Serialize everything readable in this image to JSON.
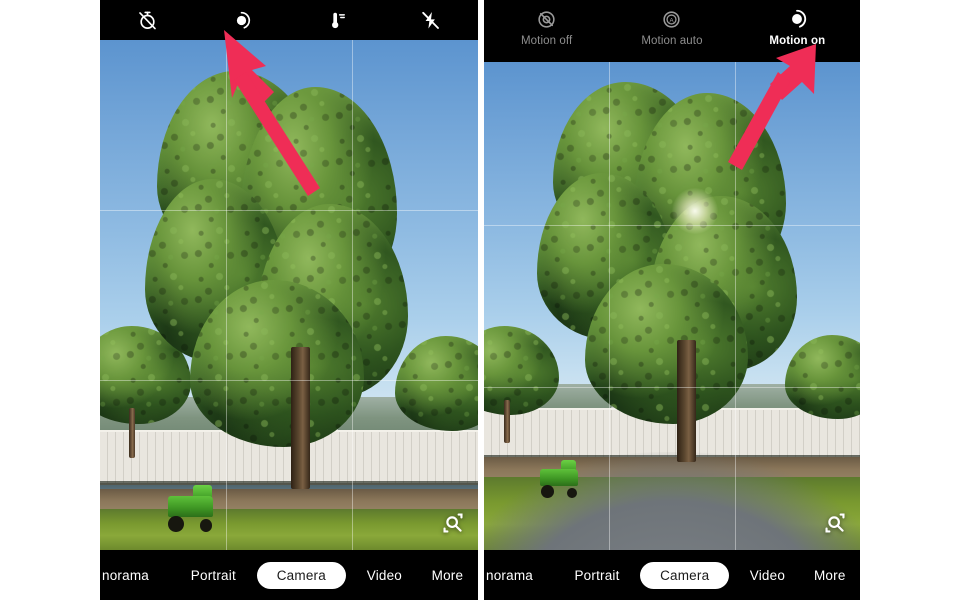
{
  "app": {
    "name": "Camera",
    "accent_pink": "#ef2d56",
    "bar_background": "#000000",
    "selected_pill_background": "#ffffff"
  },
  "left_phone": {
    "top_controls": [
      {
        "name": "timer-off",
        "label": "Timer off"
      },
      {
        "name": "motion",
        "label": "Motion"
      },
      {
        "name": "white-balance",
        "label": "White balance"
      },
      {
        "name": "flash-off",
        "label": "Flash off"
      }
    ],
    "viewfinder": {
      "grid": "rule-of-thirds",
      "zoom_badge_icon": "zoom-magnifier-icon"
    },
    "modes": [
      {
        "label": "norama",
        "selected": false,
        "clipped": true
      },
      {
        "label": "Portrait",
        "selected": false,
        "clipped": false
      },
      {
        "label": "Camera",
        "selected": true,
        "clipped": false
      },
      {
        "label": "Video",
        "selected": false,
        "clipped": false
      },
      {
        "label": "More",
        "selected": false,
        "clipped": false
      }
    ],
    "annotation": {
      "target": "motion-control",
      "direction": "up-left"
    }
  },
  "right_phone": {
    "motion_options": [
      {
        "label": "Motion off",
        "icon": "motion-off-icon",
        "selected": false
      },
      {
        "label": "Motion auto",
        "icon": "motion-auto-icon",
        "selected": false
      },
      {
        "label": "Motion on",
        "icon": "motion-on-icon",
        "selected": true
      }
    ],
    "viewfinder": {
      "grid": "rule-of-thirds",
      "zoom_badge_icon": "zoom-magnifier-icon"
    },
    "modes": [
      {
        "label": "norama",
        "selected": false,
        "clipped": true
      },
      {
        "label": "Portrait",
        "selected": false,
        "clipped": false
      },
      {
        "label": "Camera",
        "selected": true,
        "clipped": false
      },
      {
        "label": "Video",
        "selected": false,
        "clipped": false
      },
      {
        "label": "More",
        "selected": false,
        "clipped": false
      }
    ],
    "annotation": {
      "target": "motion-on-option",
      "direction": "up-right"
    }
  }
}
